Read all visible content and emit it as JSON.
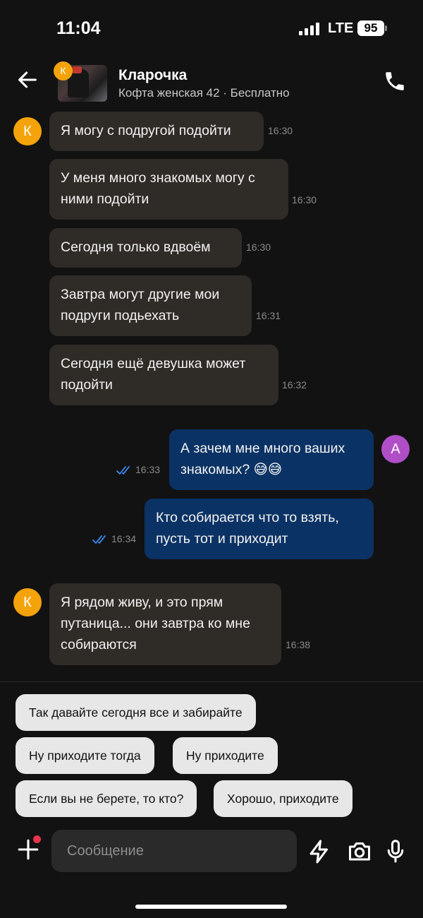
{
  "status": {
    "time": "11:04",
    "network": "LTE",
    "battery": "95"
  },
  "header": {
    "title": "Кларочка",
    "subtitle": "Кофта женская 42 · Бесплатно",
    "avatar_letter": "К"
  },
  "messages": [
    {
      "side": "in",
      "text": "Я могу с подругой подойти",
      "time": "16:30",
      "avatar": "К"
    },
    {
      "side": "in",
      "text": "У меня много знакомых могу с ними подойти",
      "time": "16:30"
    },
    {
      "side": "in",
      "text": "Сегодня только вдвоём",
      "time": "16:30"
    },
    {
      "side": "in",
      "text": "Завтра могут другие мои подруги подьехать",
      "time": "16:31"
    },
    {
      "side": "in",
      "text": "Сегодня ещё девушка может подойти",
      "time": "16:32"
    },
    {
      "side": "out",
      "text": "А зачем мне много ваших знакомых? 😅😅",
      "time": "16:33",
      "avatar": "А",
      "read": true
    },
    {
      "side": "out",
      "text": "Кто собирается что то взять, пусть тот и приходит",
      "time": "16:34",
      "read": true
    },
    {
      "side": "in",
      "text": "Я рядом живу, и это прям путаница... они завтра ко мне собираются",
      "time": "16:38",
      "avatar": "К"
    }
  ],
  "quick_replies": [
    "Так давайте сегодня все и забирайте",
    "Ну приходите тогда",
    "Ну приходите",
    "Если вы не берете, то кто?",
    "Хорошо, приходите"
  ],
  "composer": {
    "placeholder": "Сообщение"
  },
  "icons": {
    "back": "arrow-left-icon",
    "call": "phone-icon",
    "read": "double-check-icon",
    "attach": "plus-icon",
    "quick": "lightning-icon",
    "camera": "camera-icon",
    "mic": "microphone-icon"
  },
  "colors": {
    "background": "#121212",
    "incoming_bubble": "#2f2b27",
    "outgoing_bubble": "#0b3264",
    "seller_avatar": "#f4a30b",
    "user_avatar": "#b04ec8",
    "read_ticks": "#3d8af7",
    "notification_dot": "#e8344e"
  }
}
